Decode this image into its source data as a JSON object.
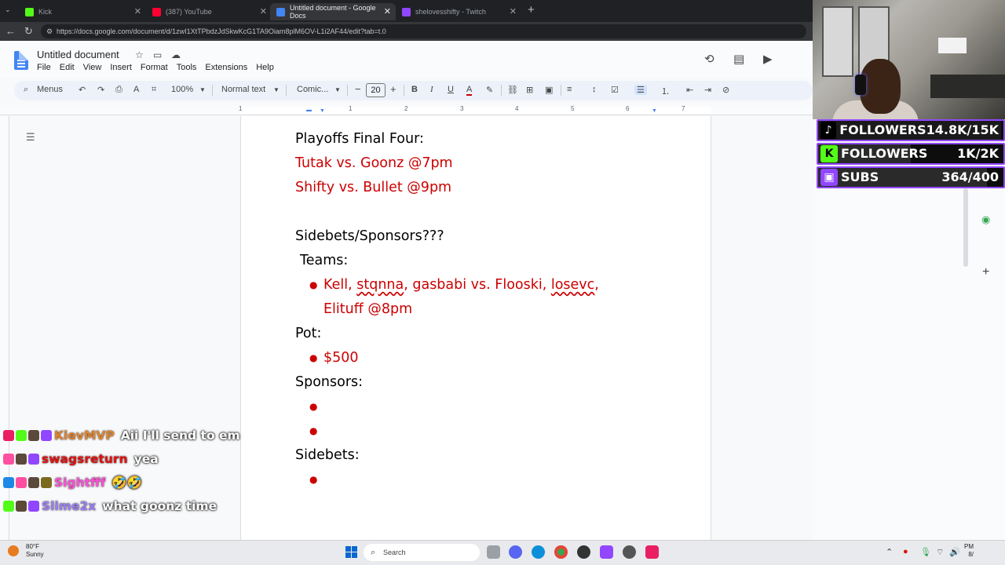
{
  "browser": {
    "tabs": [
      {
        "label": "Kick",
        "color": "#53fc18"
      },
      {
        "label": "(387) YouTube",
        "color": "#ff0033"
      },
      {
        "label": "Untitled document - Google Docs",
        "color": "#4285f4"
      },
      {
        "label": "shelovesshifty - Twitch",
        "color": "#9146ff"
      }
    ],
    "url": "https://docs.google.com/document/d/1zwI1XtTPbdzJdSkwKcG1TA9Oiam8plM6OV-L1i2AF44/edit?tab=t.0"
  },
  "docs": {
    "title": "Untitled document",
    "menu": [
      "File",
      "Edit",
      "View",
      "Insert",
      "Format",
      "Tools",
      "Extensions",
      "Help"
    ],
    "toolbar": {
      "search": "Menus",
      "zoom": "100%",
      "style": "Normal text",
      "font": "Comic...",
      "font_size": "20"
    },
    "ruler": [
      "1",
      "1",
      "2",
      "3",
      "4",
      "5",
      "6",
      "7"
    ]
  },
  "document": {
    "line1": "Playoffs Final Four:",
    "line2": "Tutak vs. Goonz @7pm",
    "line3": "Shifty vs. Bullet @9pm",
    "line4": "Sidebets/Sponsors???",
    "line5": "Teams:",
    "team_a": "Kell, ",
    "team_b": "stqnna",
    "team_c": ", gasbabi vs. Flooski, ",
    "team_d": "losevc",
    "team_e": ",",
    "team_f": "Elituff @8pm",
    "pot": "Pot:",
    "pot_value": "$500",
    "sponsors": "Sponsors:",
    "sidebets": "Sidebets:"
  },
  "overlay": {
    "stats": [
      {
        "label": "FOLLOWERS",
        "value": "14.8K/15K",
        "icon_color": "#ffffff",
        "icon": "tiktok-icon"
      },
      {
        "label": "FOLLOWERS",
        "value": "1K/2K",
        "icon_color": "#53fc18",
        "icon": "kick-icon"
      },
      {
        "label": "SUBS",
        "value": "364/400",
        "icon_color": "#9146ff",
        "icon": "twitch-icon"
      }
    ],
    "chat": [
      {
        "user": "KievMVP",
        "color": "#e0822c",
        "text": "Aii I'll send to em"
      },
      {
        "user": "swagsreturn",
        "color": "#e01010",
        "text": "yea"
      },
      {
        "user": "Sightfff",
        "color": "#ff4fd8",
        "text": "🤣🤣"
      },
      {
        "user": "Slime2x",
        "color": "#9a7df0",
        "text": "what goonz time"
      }
    ]
  },
  "taskbar": {
    "temp": "80°F",
    "condition": "Sunny",
    "search": "Search",
    "time": "PM",
    "date": "8/"
  }
}
